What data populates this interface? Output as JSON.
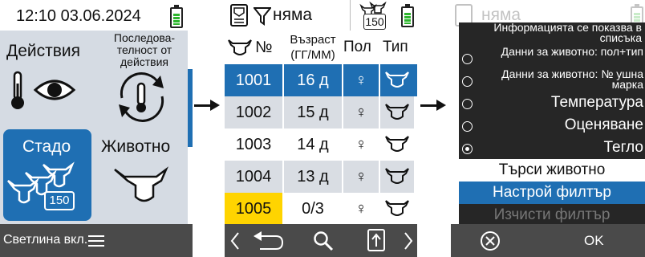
{
  "screen1": {
    "datetime": "12:10 03.06.2024",
    "battery_icon": "battery-full-icon",
    "tiles": {
      "actions_label": "Действия",
      "sequence_label": "Последова-\nтелност от\nдействия",
      "herd_label": "Стадо",
      "herd_count": "150",
      "animal_label": "Животно"
    },
    "footer_label": "Светлина вкл."
  },
  "screen2": {
    "filter_label": "няма",
    "count_badge": "150",
    "columns": {
      "number": "№",
      "age": "Възраст\n(ГГ/ММ)",
      "sex": "Пол",
      "type": "Тип"
    },
    "rows": [
      {
        "number": "1001",
        "age": "16 д",
        "sex": "♀",
        "selected": true,
        "highlight_number": false
      },
      {
        "number": "1002",
        "age": "15 д",
        "sex": "♀",
        "selected": false,
        "highlight_number": false
      },
      {
        "number": "1003",
        "age": "14 д",
        "sex": "♀",
        "selected": false,
        "highlight_number": false
      },
      {
        "number": "1004",
        "age": "13 д",
        "sex": "♀",
        "selected": false,
        "highlight_number": false
      },
      {
        "number": "1005",
        "age": "0/3",
        "sex": "♀",
        "selected": false,
        "highlight_number": true
      }
    ],
    "footer_icons": [
      "chevron-left-icon",
      "back-arrow-icon",
      "search-icon",
      "upload-icon",
      "chevron-right-icon"
    ]
  },
  "screen3": {
    "background_filter_label": "няма",
    "popup_title": "Информацията се показва в списъка",
    "options": [
      {
        "label": "Данни за животно: пол+тип",
        "selected": false,
        "small": true
      },
      {
        "label": "Данни за животно: № ушна марка",
        "selected": false,
        "small": true
      },
      {
        "label": "Температура",
        "selected": false,
        "small": false
      },
      {
        "label": "Оценяване",
        "selected": false,
        "small": false
      },
      {
        "label": "Тегло",
        "selected": true,
        "small": false
      }
    ],
    "actions": {
      "search_animal": "Търси животно",
      "set_filter": "Настрой филтър",
      "clear_filter": "Изчисти филтър"
    },
    "footer_cancel_icon": "cancel-circle-icon",
    "footer_ok": "OK"
  },
  "colors": {
    "accent_blue": "#1f6fb3",
    "menu_bg": "#d5dbe3",
    "footer_bg": "#4a4a4a",
    "row_alt": "#d9dde3",
    "highlight_yellow": "#ffd400",
    "battery_green": "#2db52d",
    "popup_bg": "#262626"
  }
}
